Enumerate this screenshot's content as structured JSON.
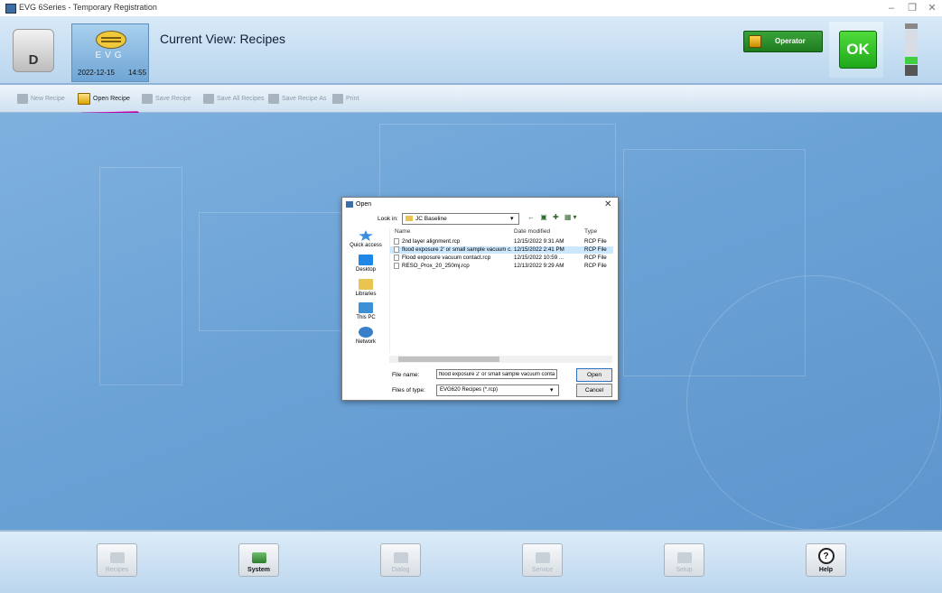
{
  "window": {
    "title": "EVG 6Series - Temporary Registration",
    "controls": [
      "–",
      "❐",
      "✕"
    ]
  },
  "header": {
    "user_initial": "D",
    "logo_text": "EVG",
    "date": "2022-12-15",
    "time": "14:55",
    "current_view": "Current View: Recipes",
    "operator_label": "Operator",
    "ok_label": "OK"
  },
  "toolbar": {
    "items": [
      {
        "label": "New Recipe",
        "enabled": false
      },
      {
        "label": "Open Recipe",
        "enabled": true
      },
      {
        "label": "Save Recipe",
        "enabled": false
      },
      {
        "label": "Save All Recipes",
        "enabled": false
      },
      {
        "label": "Save Recipe As",
        "enabled": false
      },
      {
        "label": "Print",
        "enabled": false
      }
    ]
  },
  "dialog": {
    "title": "Open",
    "close": "✕",
    "look_in_label": "Look in:",
    "look_in_value": "JC Baseline",
    "nav_icons": "← ▣ ✚ ▦▾",
    "places": [
      "Quick access",
      "Desktop",
      "Libraries",
      "This PC",
      "Network"
    ],
    "columns": {
      "name": "Name",
      "date": "Date modified",
      "type": "Type"
    },
    "files": [
      {
        "name": "2nd layer alignment.rcp",
        "date": "12/15/2022 9:31 AM",
        "type": "RCP File",
        "selected": false
      },
      {
        "name": "flood exposure 2' or small sample vacuum c...",
        "date": "12/15/2022 2:41 PM",
        "type": "RCP File",
        "selected": true
      },
      {
        "name": "Flood exposure vacuum contact.rcp",
        "date": "12/15/2022 10:59 ...",
        "type": "RCP File",
        "selected": false
      },
      {
        "name": "RESO_Prox_20_250mj.rcp",
        "date": "12/13/2022 9:29 AM",
        "type": "RCP File",
        "selected": false
      }
    ],
    "file_name_label": "File name:",
    "file_name_value": "flood exposure 2' or small sample vacuum conta",
    "file_type_label": "Files of type:",
    "file_type_value": "EVG620 Recipes (*.rcp)",
    "open_label": "Open",
    "cancel_label": "Cancel"
  },
  "bottom_nav": [
    {
      "label": "Recipes",
      "enabled": false
    },
    {
      "label": "System",
      "enabled": true
    },
    {
      "label": "Dialog",
      "enabled": false
    },
    {
      "label": "Service",
      "enabled": false
    },
    {
      "label": "Setup",
      "enabled": false
    },
    {
      "label": "Help",
      "enabled": true
    }
  ],
  "colors": {
    "accent_pink": "#c000a8",
    "ok_green": "#1fa71a",
    "background_blue": "#6ba2d6"
  }
}
